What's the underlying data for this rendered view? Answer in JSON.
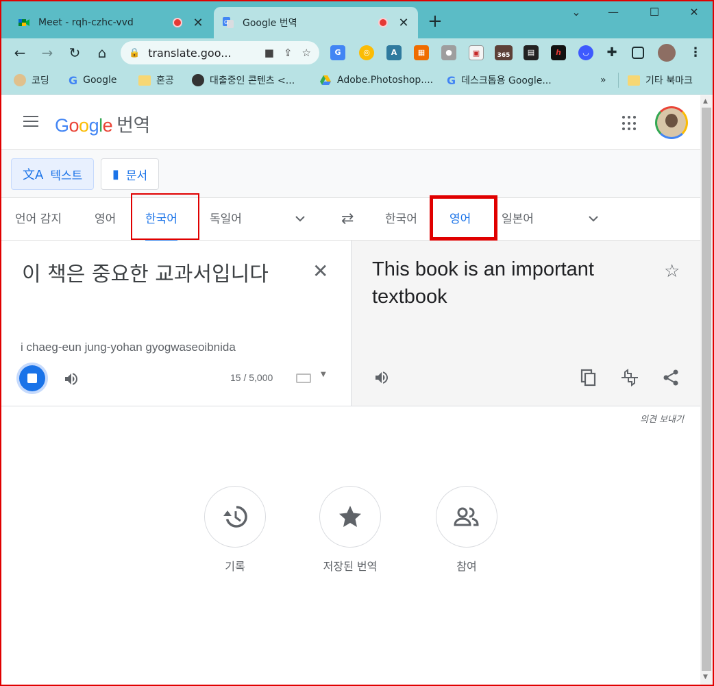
{
  "browser": {
    "tabs": [
      {
        "title": "Meet - rqh-czhc-vvd",
        "active": false
      },
      {
        "title": "Google 번역",
        "active": true
      }
    ],
    "new_tab_label": "+",
    "window_controls": {
      "minimize": "—",
      "maximize": "☐",
      "close": "✕"
    },
    "url": "translate.goo...",
    "bookmarks": [
      {
        "label": "코딩",
        "icon": "dog-icon"
      },
      {
        "label": "Google",
        "icon": "google-icon"
      },
      {
        "label": "혼공",
        "icon": "folder-icon"
      },
      {
        "label": "대출중인 콘텐츠 <...",
        "icon": "globe-icon"
      },
      {
        "label": "Adobe.Photoshop....",
        "icon": "drive-icon"
      },
      {
        "label": "데스크톱용 Google...",
        "icon": "google-icon"
      }
    ],
    "bookmarks_overflow": "»",
    "other_bookmarks": "기타 북마크",
    "extension_badge": "365"
  },
  "app": {
    "logo_word": "Google",
    "logo_suffix": "번역",
    "modes": [
      {
        "label": "텍스트",
        "selected": true
      },
      {
        "label": "문서",
        "selected": false
      }
    ],
    "source_langs": [
      "언어 감지",
      "영어",
      "한국어",
      "독일어"
    ],
    "source_selected_index": 2,
    "target_langs": [
      "한국어",
      "영어",
      "일본어"
    ],
    "target_selected_index": 1
  },
  "source": {
    "text": "이 책은 중요한 교과서입니다",
    "romanization": "i chaeg-eun jung-yohan gyogwaseoibnida",
    "char_count": "15 / 5,000"
  },
  "target": {
    "text": "This book is an important textbook"
  },
  "feedback_label": "의견 보내기",
  "bottom_links": [
    {
      "label": "기록",
      "icon": "history-icon"
    },
    {
      "label": "저장된 번역",
      "icon": "star-icon"
    },
    {
      "label": "참여",
      "icon": "people-icon"
    }
  ],
  "colors": {
    "accent": "#1a73e8",
    "highlight_box": "#e00000",
    "tab_strip": "#5bbcc6",
    "toolbar": "#b8e2e4"
  }
}
